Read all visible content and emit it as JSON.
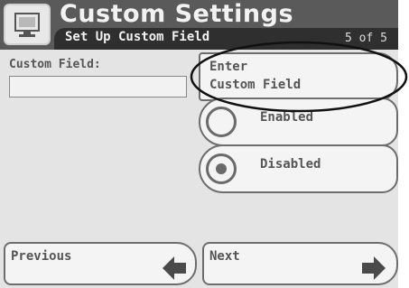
{
  "header": {
    "title": "Custom Settings",
    "subtitle": "Set Up Custom Field",
    "page_indicator": "5 of 5",
    "icon": "monitor-icon"
  },
  "field": {
    "label": "Custom Field:",
    "value": ""
  },
  "buttons": {
    "enter_line1": "Enter",
    "enter_line2": "Custom Field",
    "enabled_label": "Enabled",
    "disabled_label": "Disabled",
    "selected": "Disabled",
    "previous_label": "Previous",
    "next_label": "Next"
  },
  "icons": {
    "previous": "left-arrow-icon",
    "next": "right-arrow-icon"
  }
}
